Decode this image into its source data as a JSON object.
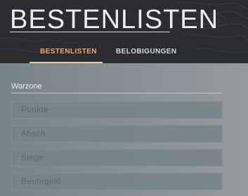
{
  "header": {
    "title": "BESTENLISTEN",
    "tabs": [
      {
        "label": "BESTENLISTEN",
        "active": true
      },
      {
        "label": "BELOBIGUNGEN",
        "active": false
      }
    ]
  },
  "section": {
    "label": "Warzone",
    "items": [
      "Punkte",
      "Absch",
      "Siege",
      "Beutegeld"
    ]
  },
  "colors": {
    "accent": "#f2a56c",
    "header_bg": "#2a2c2f"
  }
}
